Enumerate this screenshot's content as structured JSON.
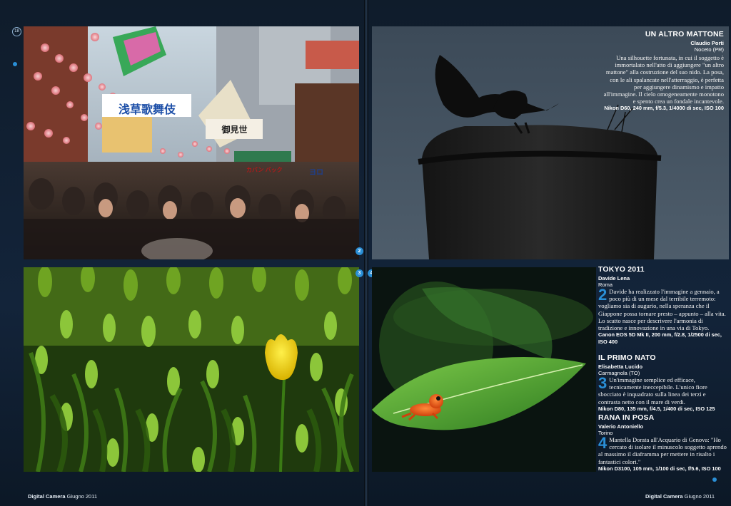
{
  "page_numbers": {
    "left": "18",
    "right": ""
  },
  "photo_numbers": {
    "tokyo": "2",
    "tulip": "3",
    "frog": "4"
  },
  "footer": {
    "left_magazine": "Digital Camera",
    "left_issue": " Giugno 2011",
    "right_magazine": "Digital Camera",
    "right_issue": " Giugno 2011"
  },
  "photo1_signs": {
    "big_sign": "浅草歌舞伎",
    "sign2": "御見世",
    "sign3": "カバン バック",
    "sign4": "ヨロ"
  },
  "captions": {
    "mattone": {
      "title": "UN ALTRO MATTONE",
      "author": "Claudio Porti",
      "place": "Noceto (PR)",
      "body": "Una silhouette fortunata, in cui il soggetto è immortalato nell'atto di aggiungere \"un altro mattone\" alla costruzione del suo nido. La posa, con le ali spalancate nell'atterraggio, è perfetta per aggiungere dinamismo e impatto all'immagine. Il cielo omogeneamente monotono e spento crea un fondale incantevole.",
      "specs": "Nikon D60, 240 mm, f/5.3, 1/4000 di sec, ISO 100"
    },
    "tokyo": {
      "title": "TOKYO 2011",
      "author": "Davide Lena",
      "place": "Roma",
      "number": "2",
      "body": "Davide ha realizzato l'immagine a gennaio, a poco più di un mese dal terribile terremoto: vogliamo sia di augurio, nella speranza che il Giappone possa tornare presto – appunto – alla vita. Lo scatto nasce per descrivere l'armonia di tradizione e innovazione in una via di Tokyo.",
      "specs": "Canon EOS 5D Mk II, 200 mm, f/2.8, 1/2500 di sec, ISO 400"
    },
    "nato": {
      "title": "IL PRIMO NATO",
      "author": "Elisabetta Lucido",
      "place": "Carmagnola (TO)",
      "number": "3",
      "body": "Un'immagine semplice ed efficace, tecnicamente ineccepibile. L'unico fiore sbocciato è inquadrato sulla linea dei terzi e contrasta netto con il mare di verdi.",
      "specs": "Nikon D80, 135 mm, f/4.5, 1/400 di sec, ISO 125"
    },
    "rana": {
      "title": "RANA IN POSA",
      "author": "Valerio Antoniello",
      "place": "Torino",
      "number": "4",
      "body": "Mantella Dorata all'Acquario di Genova: \"Ho cercato di isolare il minuscolo soggetto aprendo al massimo il diaframma per mettere in risalto i fantastici colori.\"",
      "specs": "Nikon D3100, 105 mm, 1/100 di sec, f/5.6, ISO 100"
    }
  },
  "colors": {
    "accent": "#2a8fd6",
    "page_bg": "#13243a"
  }
}
